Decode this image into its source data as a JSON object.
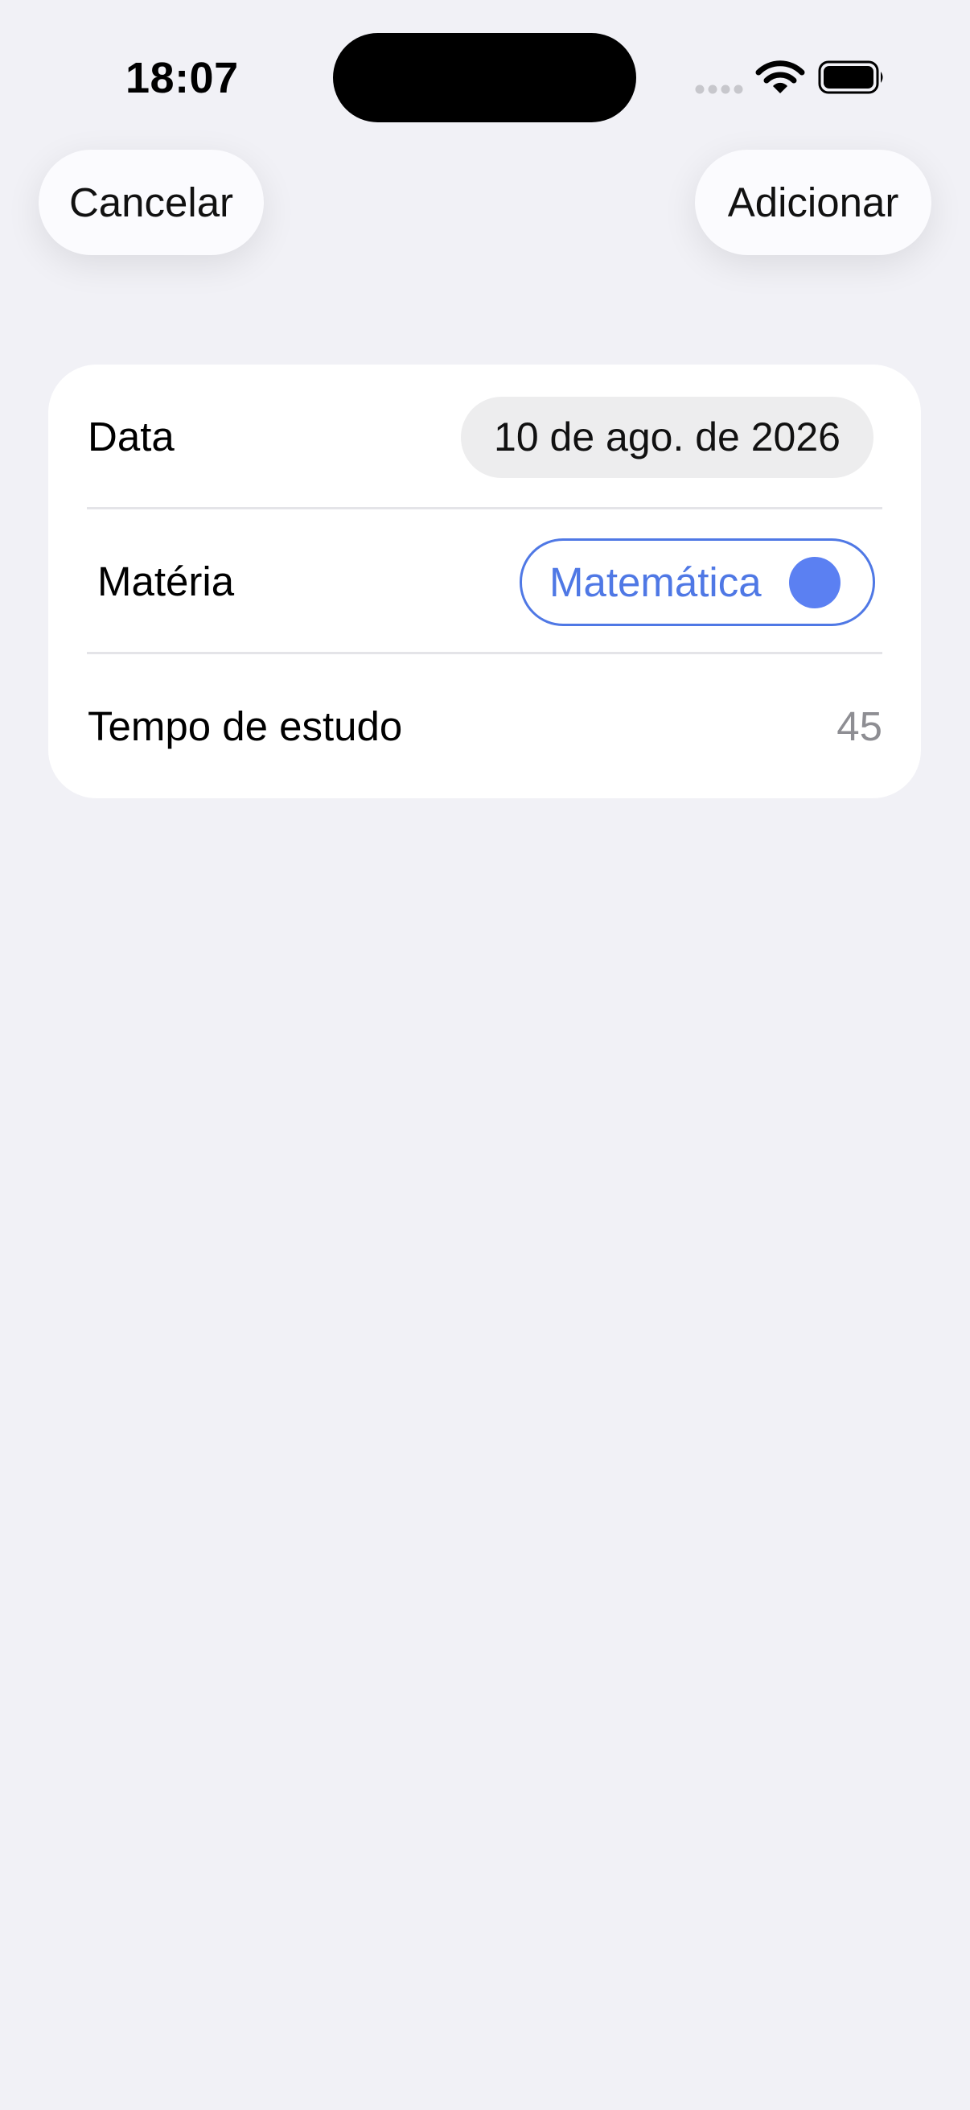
{
  "status_bar": {
    "time": "18:07",
    "icons": [
      "cellular-signal-icon",
      "wifi-icon",
      "battery-icon"
    ]
  },
  "nav": {
    "cancel_label": "Cancelar",
    "add_label": "Adicionar"
  },
  "form": {
    "date": {
      "label": "Data",
      "value": "10 de ago. de 2026"
    },
    "subject": {
      "label": "Matéria",
      "value": "Matemática",
      "color": "#5b80f2"
    },
    "study_time": {
      "label": "Tempo de estudo",
      "value": "45"
    }
  },
  "colors": {
    "background": "#f1f1f6",
    "card": "#ffffff",
    "accent": "#4f78e5",
    "secondary_text": "#8e8e93"
  }
}
